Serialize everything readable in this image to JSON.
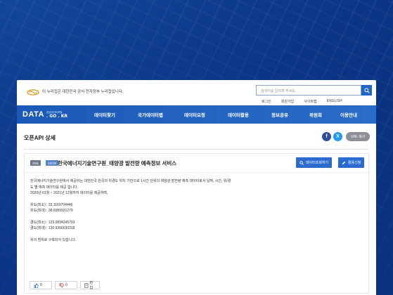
{
  "colors": {
    "brand_blue": "#1b59b8",
    "button_blue": "#2b6bd0",
    "tag_xml": "#6e7b8f",
    "tag_json": "#5a86c8",
    "facebook": "#2d4f9a",
    "twitter": "#1d9bf0",
    "url_gray": "#8c8f96"
  },
  "topbar": {
    "gov_notice": "이 누리집은 대한민국 공식 전자정부 누리집입니다.",
    "search_placeholder": "검색어를 입력해 주세요.",
    "links": [
      "로그인",
      "회원가입",
      "사이트맵",
      "ENGLISH"
    ]
  },
  "logo": {
    "main": "DATA",
    "sub_small": "공공데이터포털",
    "sub_domain": ". GO . KR"
  },
  "nav": {
    "items": [
      "데이터찾기",
      "국가데이터맵",
      "데이터요청",
      "데이터활용",
      "정보공유",
      "위원회",
      "이용안내"
    ]
  },
  "page": {
    "title": "오픈API 상세",
    "share": {
      "facebook_icon": "f",
      "twitter_icon": "X",
      "url_copy": "URL 복사"
    }
  },
  "dataset": {
    "tags": [
      "XML",
      "JSON"
    ],
    "title": "한국에너지기술연구원_태양광 발전량 예측정보 서비스",
    "preview_button": "데이터조회하기",
    "apply_button": "활용신청",
    "description": [
      "한국에너지기술연구원에서 제공하는 대한민국 한국의 위경도 위치 기반으로 1시간 단위의 태양광 발전량 예측 데이터로서 날짜, 시간, 위/경",
      "도 별 예측 데이터를 제공 합니다.",
      "2020년 01월 ~ 2021년 12월까지 데이터를 제공하며,",
      "",
      "위도(최소) : 33.1160704446",
      "위도(최대) : 38.6089931279",
      "",
      "경도(최소) : 125.0834245793",
      "경도(최대) : 130.9366030318",
      "",
      "위의 범위로 구축되어 있습니다."
    ],
    "like_count": "0",
    "dislike_count": "0",
    "edit_label": "편집"
  }
}
